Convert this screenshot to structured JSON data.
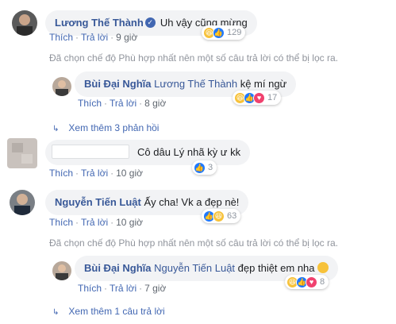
{
  "comments": [
    {
      "author": "Lương Thế Thành",
      "text": "Uh vậy cũng mừng",
      "like_label": "Thích",
      "reply_label": "Trả lời",
      "time": "9 giờ",
      "reaction_count": "129",
      "reactions": [
        "haha-icon",
        "like-icon"
      ]
    },
    {
      "author": "Bùi Đại Nghĩa",
      "mention": "Lương Thế Thành",
      "text": "kệ mí ngừ",
      "like_label": "Thích",
      "reply_label": "Trả lời",
      "time": "8 giờ",
      "reaction_count": "17",
      "reactions": [
        "haha-icon",
        "like-icon",
        "love-icon"
      ]
    },
    {
      "author": "",
      "text": "Cô dâu Lý nhã kỳ ư kk",
      "like_label": "Thích",
      "reply_label": "Trả lời",
      "time": "10 giờ",
      "reaction_count": "3",
      "reactions": [
        "like-icon"
      ]
    },
    {
      "author": "Nguyễn Tiến Luật",
      "text": "Ấy cha! Vk a đẹp nè!",
      "like_label": "Thích",
      "reply_label": "Trả lời",
      "time": "10 giờ",
      "reaction_count": "63",
      "reactions": [
        "like-icon",
        "haha-icon"
      ]
    },
    {
      "author": "Bùi Đại Nghĩa",
      "mention": "Nguyễn Tiến Luật",
      "text": "đẹp thiệt em nha",
      "like_label": "Thích",
      "reply_label": "Trả lời",
      "time": "7 giờ",
      "reaction_count": "8",
      "reactions": [
        "haha-icon",
        "like-icon",
        "love-icon"
      ]
    }
  ],
  "filter_notice": "Đã chọn chế độ Phù hợp nhất nên một số câu trả lời có thể bị lọc ra.",
  "view_more_1": "Xem thêm 3 phản hồi",
  "view_more_2": "Xem thêm 1 câu trả lời",
  "verified_icon": "check-badge-icon",
  "colors": {
    "link": "#385898",
    "action": "#4267b2",
    "bubble": "#f2f3f5",
    "muted": "#90949c",
    "haha": "#f7c23a",
    "like": "#1f79ff",
    "love": "#f0416e"
  }
}
